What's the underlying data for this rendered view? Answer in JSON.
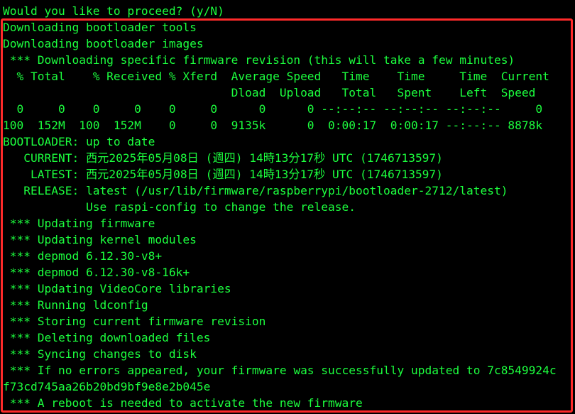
{
  "terminal": {
    "lines": [
      "Would you like to proceed? (y/N)",
      "Downloading bootloader tools",
      "Downloading bootloader images",
      " *** Downloading specific firmware revision (this will take a few minutes)",
      "  % Total    % Received % Xferd  Average Speed   Time    Time     Time  Current",
      "                                 Dload  Upload   Total   Spent    Left  Speed",
      "  0     0    0     0    0     0      0      0 --:--:-- --:--:-- --:--:--     0",
      "100  152M  100  152M    0     0  9135k      0  0:00:17  0:00:17 --:--:-- 8878k",
      "BOOTLOADER: up to date",
      "   CURRENT: 西元2025年05月08日 (週四) 14時13分17秒 UTC (1746713597)",
      "    LATEST: 西元2025年05月08日 (週四) 14時13分17秒 UTC (1746713597)",
      "   RELEASE: latest (/usr/lib/firmware/raspberrypi/bootloader-2712/latest)",
      "            Use raspi-config to change the release.",
      " *** Updating firmware",
      " *** Updating kernel modules",
      " *** depmod 6.12.30-v8+",
      " *** depmod 6.12.30-v8-16k+",
      " *** Updating VideoCore libraries",
      " *** Running ldconfig",
      " *** Storing current firmware revision",
      " *** Deleting downloaded files",
      " *** Syncing changes to disk",
      " *** If no errors appeared, your firmware was successfully updated to 7c8549924c",
      "f73cd745aa26b20bd9bf9e8e2b045e",
      " *** A reboot is needed to activate the new firmware"
    ]
  },
  "colors": {
    "background": "#000000",
    "text": "#1cff3e",
    "highlight_border": "#ff2a2a"
  }
}
